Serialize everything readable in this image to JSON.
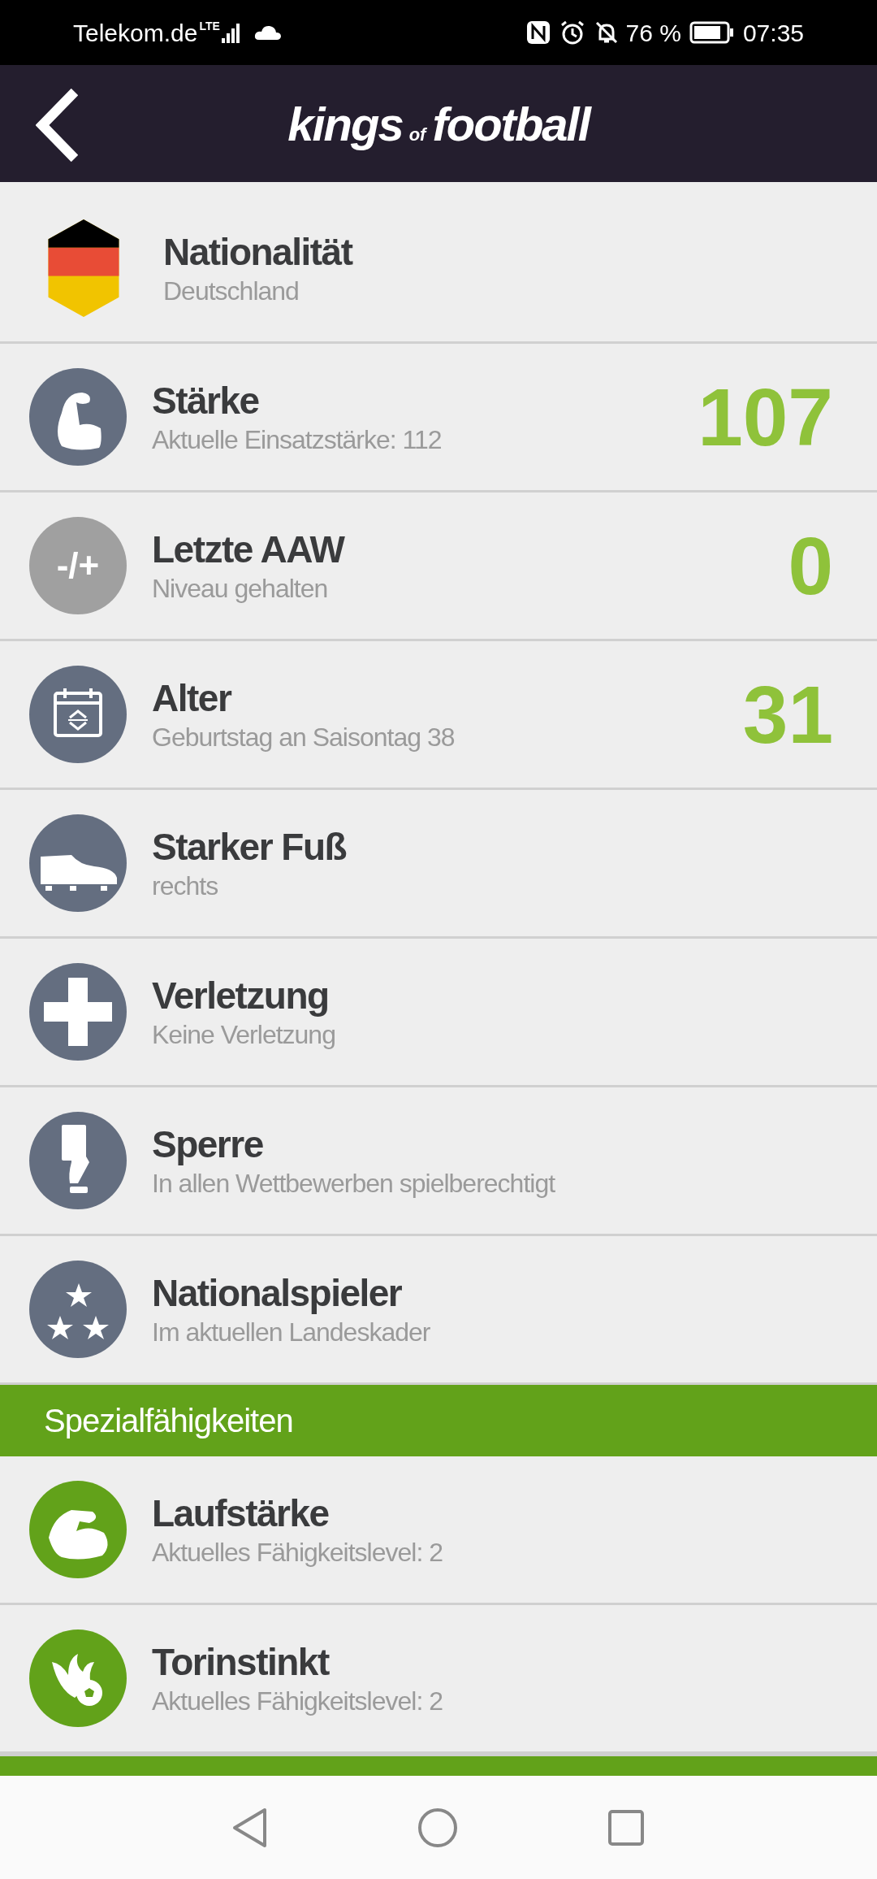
{
  "status_bar": {
    "carrier": "Telekom.de",
    "network": "LTE",
    "battery": "76 %",
    "time": "07:35"
  },
  "header": {
    "logo_main": "kings",
    "logo_small": "of",
    "logo_end": "football"
  },
  "rows": [
    {
      "title": "Nationalität",
      "subtitle": "Deutschland"
    },
    {
      "title": "Stärke",
      "subtitle": "Aktuelle Einsatzstärke: 112",
      "value": "107"
    },
    {
      "title": "Letzte AAW",
      "subtitle": "Niveau gehalten",
      "value": "0",
      "icon_text": "-/+"
    },
    {
      "title": "Alter",
      "subtitle": "Geburtstag an Saisontag 38",
      "value": "31"
    },
    {
      "title": "Starker Fuß",
      "subtitle": "rechts"
    },
    {
      "title": "Verletzung",
      "subtitle": "Keine Verletzung"
    },
    {
      "title": "Sperre",
      "subtitle": "In allen Wettbewerben spielberechtigt"
    },
    {
      "title": "Nationalspieler",
      "subtitle": "Im aktuellen Landeskader"
    }
  ],
  "section": {
    "title": "Spezialfähigkeiten"
  },
  "skills": [
    {
      "title": "Laufstärke",
      "subtitle": "Aktuelles Fähigkeitslevel: 2"
    },
    {
      "title": "Torinstinkt",
      "subtitle": "Aktuelles Fähigkeitslevel: 2"
    }
  ]
}
